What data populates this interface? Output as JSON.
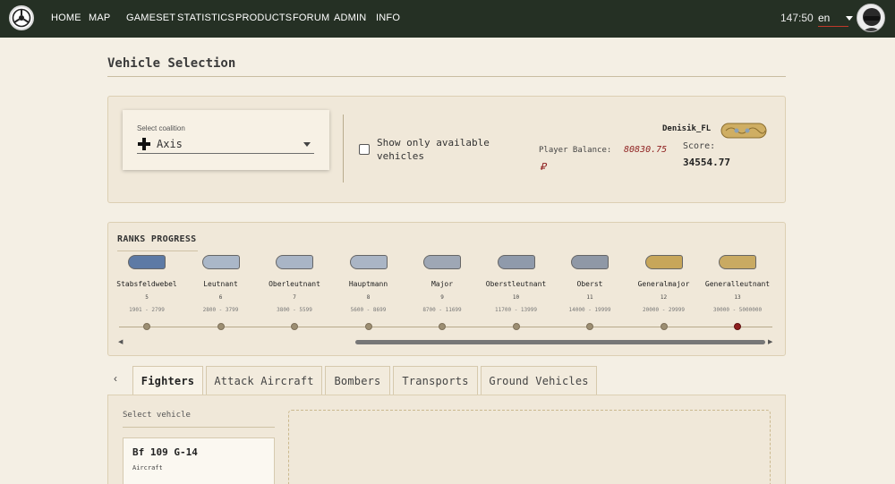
{
  "nav": {
    "items": [
      {
        "label": "HOME"
      },
      {
        "label": "MAP"
      },
      {
        "label": "GAMESET"
      },
      {
        "label": "STATISTICS"
      },
      {
        "label": "PRODUCTS"
      },
      {
        "label": "FORUM"
      },
      {
        "label": "ADMIN"
      },
      {
        "label": "INFO"
      }
    ],
    "timer": "147:50",
    "language": "en"
  },
  "page": {
    "title": "Vehicle Selection"
  },
  "coalition": {
    "label": "Select coalition",
    "value": "Axis"
  },
  "filter": {
    "show_available_line1": "Show only available",
    "show_available_line2": "vehicles",
    "checked": false
  },
  "player": {
    "name": "Denisik_FL",
    "balance_label": "Player Balance:",
    "balance_value": "80830.75",
    "currency": "₽",
    "score_label": "Score:",
    "score_value": "34554.77"
  },
  "ranks": {
    "title": "RANKS PROGRESS",
    "current_index": 8,
    "items": [
      {
        "name": "Stabsfeldwebel",
        "number": "5",
        "range": "1901 - 2799",
        "color": "#5d7aa5"
      },
      {
        "name": "Leutnant",
        "number": "6",
        "range": "2800 - 3799",
        "color": "#aab7c8"
      },
      {
        "name": "Oberleutnant",
        "number": "7",
        "range": "3800 - 5599",
        "color": "#a9b5c6"
      },
      {
        "name": "Hauptmann",
        "number": "8",
        "range": "5600 - 8699",
        "color": "#aab5c5"
      },
      {
        "name": "Major",
        "number": "9",
        "range": "8700 - 11699",
        "color": "#9ea7b5"
      },
      {
        "name": "Oberstleutnant",
        "number": "10",
        "range": "11700 - 13999",
        "color": "#8f9aab"
      },
      {
        "name": "Oberst",
        "number": "11",
        "range": "14000 - 19999",
        "color": "#8f98a6"
      },
      {
        "name": "Generalmajor",
        "number": "12",
        "range": "20000 - 29999",
        "color": "#c7a65a"
      },
      {
        "name": "Generalleutnant",
        "number": "13",
        "range": "30000 - 5000000",
        "color": "#c9aa62"
      }
    ]
  },
  "tabs": [
    {
      "label": "Fighters",
      "active": true
    },
    {
      "label": "Attack Aircraft",
      "active": false
    },
    {
      "label": "Bombers",
      "active": false
    },
    {
      "label": "Transports",
      "active": false
    },
    {
      "label": "Ground Vehicles",
      "active": false
    }
  ],
  "vehicles": {
    "title": "Select vehicle",
    "items": [
      {
        "name": "Bf 109 G-14",
        "type": "Aircraft"
      }
    ]
  }
}
